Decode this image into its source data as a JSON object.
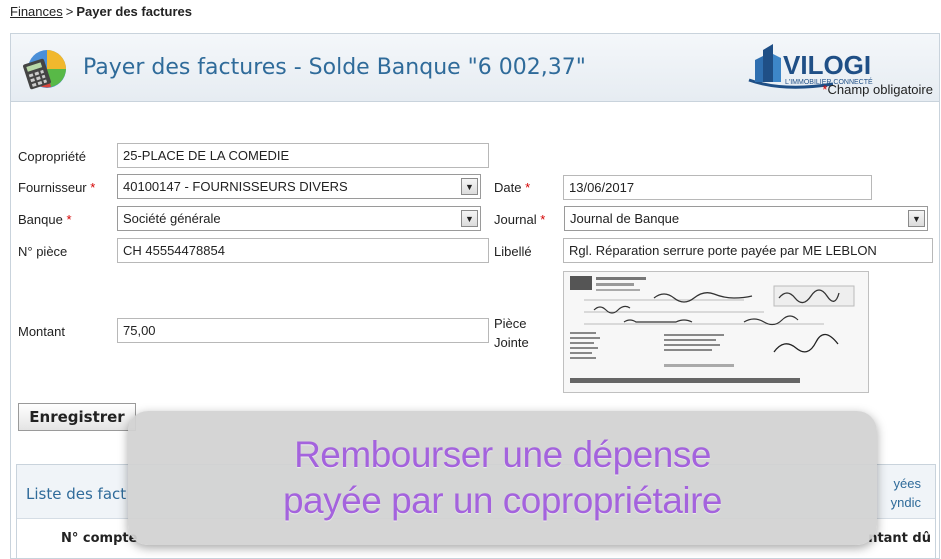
{
  "breadcrumb": {
    "parent": "Finances",
    "separator": ">",
    "current": "Payer des factures"
  },
  "header": {
    "title": "Payer des factures - Solde Banque \"6 002,37\"",
    "logo_text": "VILOGI",
    "logo_tagline": "L'IMMOBILIER CONNECTÉ"
  },
  "form": {
    "required_note": "Champ obligatoire",
    "required_mark": "*",
    "copropriete": {
      "label": "Copropriété",
      "value": "25-PLACE DE LA COMEDIE"
    },
    "fournisseur": {
      "label": "Fournisseur",
      "value": "40100147 - FOURNISSEURS DIVERS"
    },
    "date": {
      "label": "Date",
      "value": "13/06/2017"
    },
    "banque": {
      "label": "Banque",
      "value": "Société générale"
    },
    "journal": {
      "label": "Journal",
      "value": "Journal de Banque"
    },
    "piece": {
      "label": "N° pièce",
      "value": "CH 45554478854"
    },
    "libelle": {
      "label": "Libellé",
      "value": "Rgl. Réparation serrure porte payée par ME LEBLON"
    },
    "montant": {
      "label": "Montant",
      "value": "75,00"
    },
    "piece_jointe": {
      "label_line1": "Pièce",
      "label_line2": "Jointe"
    },
    "save_label": "Enregistrer"
  },
  "list": {
    "title": "Liste des fact",
    "link_line1": "yées",
    "link_line2": "yndic",
    "col_account": "N° compte",
    "col_due": "ntant dû"
  },
  "overlay": {
    "line1": "Rembourser une dépense",
    "line2": "payée par un copropriétaire"
  },
  "colors": {
    "title_blue": "#2f6b9a",
    "required_red": "#d40000",
    "overlay_text": "#a463dd"
  }
}
